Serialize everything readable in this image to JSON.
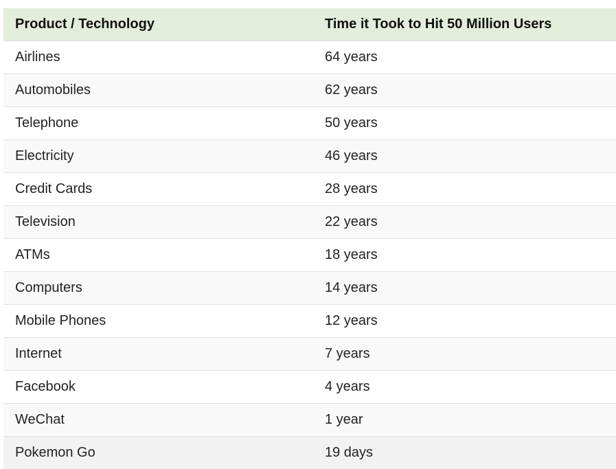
{
  "table": {
    "headers": [
      "Product / Technology",
      "Time it Took to Hit 50 Million Users"
    ],
    "rows": [
      {
        "product": "Airlines",
        "time": "64 years"
      },
      {
        "product": "Automobiles",
        "time": "62 years"
      },
      {
        "product": "Telephone",
        "time": "50 years"
      },
      {
        "product": "Electricity",
        "time": "46 years"
      },
      {
        "product": "Credit Cards",
        "time": "28 years"
      },
      {
        "product": "Television",
        "time": "22 years"
      },
      {
        "product": "ATMs",
        "time": "18 years"
      },
      {
        "product": "Computers",
        "time": "14 years"
      },
      {
        "product": "Mobile Phones",
        "time": "12 years"
      },
      {
        "product": "Internet",
        "time": "7 years"
      },
      {
        "product": "Facebook",
        "time": "4 years"
      },
      {
        "product": "WeChat",
        "time": "1 year"
      },
      {
        "product": "Pokemon Go",
        "time": "19 days"
      }
    ]
  },
  "colors": {
    "header_bg": "#e3eddb",
    "row_alt_bg": "#f9f9f9",
    "row_hover_bg": "#f2f2f2",
    "border": "#e2e2e2"
  }
}
